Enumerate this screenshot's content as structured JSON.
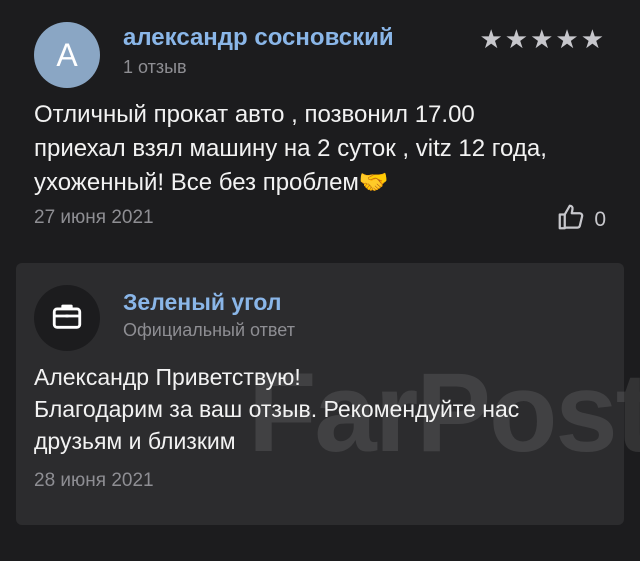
{
  "review": {
    "avatar_letter": "А",
    "author": "александр сосновский",
    "meta": "1 отзыв",
    "stars": "★★★★★",
    "rating": 5,
    "text_lines": [
      "Отличный прокат авто , позвонил 17.00",
      "приехал взял машину на 2 суток , vitz 12 года,",
      "ухоженный! Все без проблем🤝"
    ],
    "date": "27 июня 2021",
    "likes": "0"
  },
  "reply": {
    "author": "Зеленый угол",
    "role": "Официальный ответ",
    "text_lines": [
      "Александр Приветствую!",
      "Благодарим за ваш отзыв. Рекомендуйте нас",
      "друзьям и близким"
    ],
    "date": "28 июня 2021"
  },
  "watermark": "FarPost.ru",
  "colors": {
    "background": "#1c1c1e",
    "card": "#2c2c2e",
    "link": "#8ab6e8",
    "muted": "#8e8e93",
    "avatar": "#8aa6c4"
  },
  "icons": {
    "like": "thumbs-up-icon",
    "business": "briefcase-icon",
    "rating": "star-icon"
  }
}
